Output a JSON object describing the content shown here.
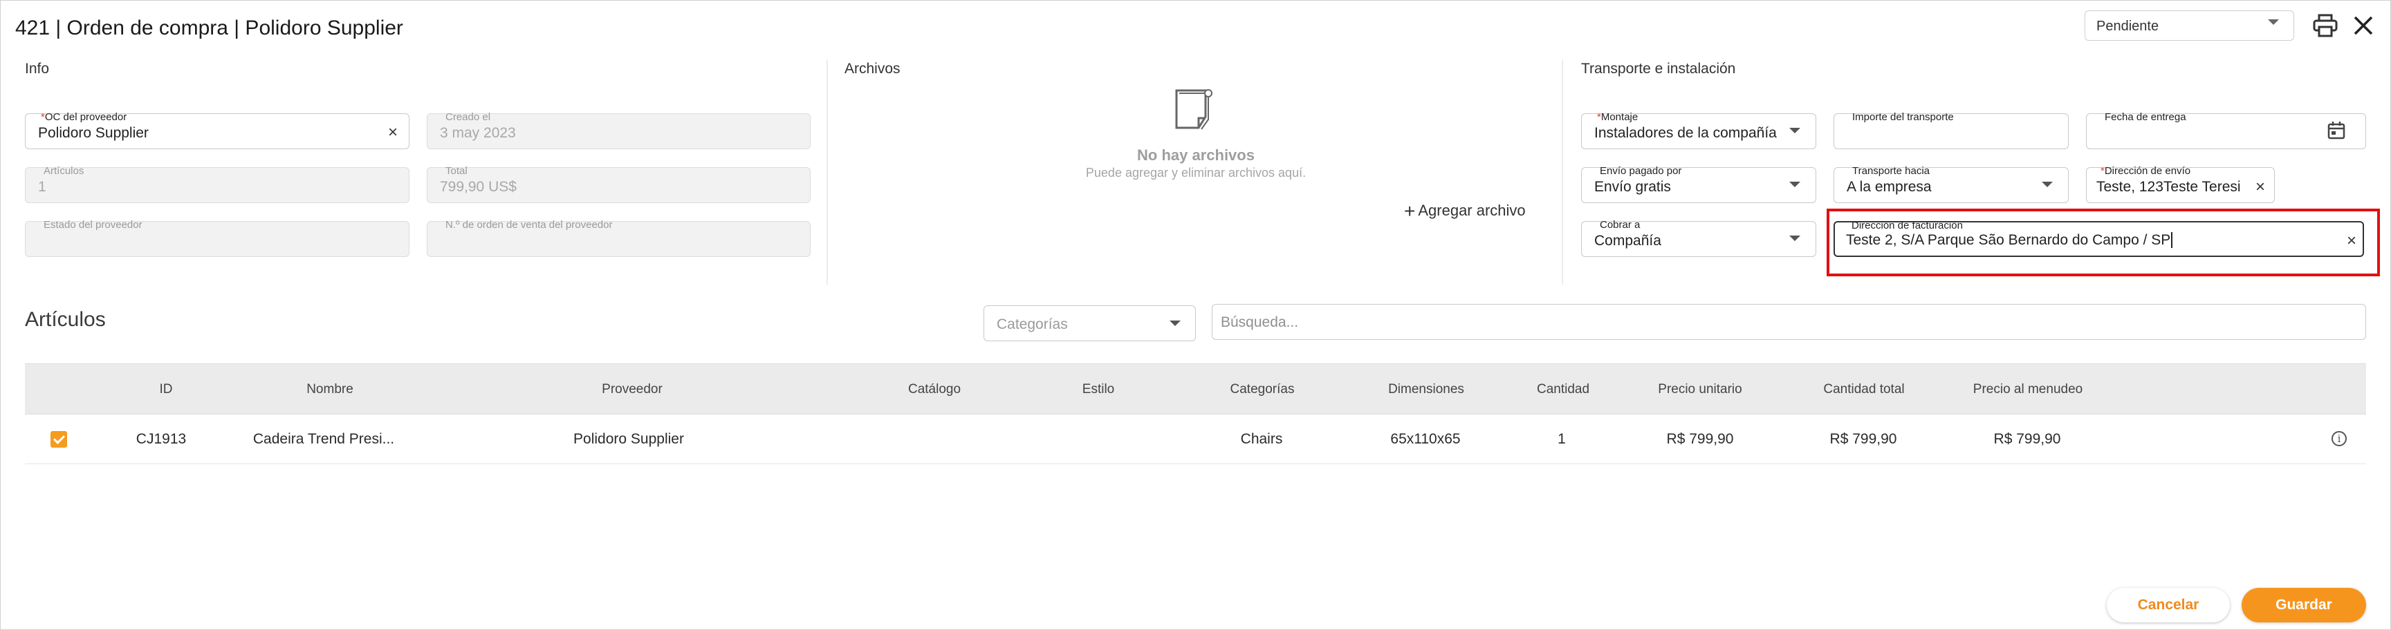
{
  "header": {
    "title": "421 | Orden de compra | Polidoro Supplier",
    "status": "Pendiente"
  },
  "info": {
    "section_title": "Info",
    "oc_label": "OC del proveedor",
    "oc_value": "Polidoro Supplier",
    "creado_label": "Creado el",
    "creado_value": "3 may 2023",
    "articulos_label": "Artículos",
    "articulos_value": "1",
    "total_label": "Total",
    "total_value": "799,90 US$",
    "estado_label": "Estado del proveedor",
    "orden_venta_label": "N.º de orden de venta del proveedor"
  },
  "archivos": {
    "section_title": "Archivos",
    "empty_title": "No hay archivos",
    "empty_subtitle": "Puede agregar y eliminar archivos aquí.",
    "add_label": "Agregar archivo"
  },
  "transporte": {
    "section_title": "Transporte e instalación",
    "montaje_label": "Montaje",
    "montaje_value": "Instaladores de la compañía",
    "importe_label": "Importe del transporte",
    "fecha_label": "Fecha de entrega",
    "envio_pagado_label": "Envío pagado por",
    "envio_pagado_value": "Envío gratis",
    "transporte_hacia_label": "Transporte hacia",
    "transporte_hacia_value": "A la empresa",
    "direccion_envio_label": "Dirección de envío",
    "direccion_envio_value": "Teste, 123Teste Teresi",
    "cobrar_label": "Cobrar a",
    "cobrar_value": "Compañía",
    "facturacion_label": "Dirección de facturación",
    "facturacion_value": "Teste 2, S/A Parque  São Bernardo do Campo / SP"
  },
  "articulos": {
    "title": "Artículos",
    "categorias_placeholder": "Categorías",
    "search_placeholder": "Búsqueda...",
    "columns": [
      "ID",
      "Nombre",
      "Proveedor",
      "Catálogo",
      "Estilo",
      "Categorías",
      "Dimensiones",
      "Cantidad",
      "Precio unitario",
      "Cantidad total",
      "Precio al menudeo"
    ],
    "rows": [
      {
        "id": "CJ1913",
        "nombre": "Cadeira Trend Presi...",
        "proveedor": "Polidoro Supplier",
        "catalogo": "",
        "estilo": "",
        "categorias": "Chairs",
        "dimensiones": "65x110x65",
        "cantidad": "1",
        "precio_unitario": "R$ 799,90",
        "cantidad_total": "R$ 799,90",
        "precio_menudeo": "R$ 799,90",
        "checked": true
      }
    ]
  },
  "footer": {
    "cancel": "Cancelar",
    "save": "Guardar"
  },
  "colors": {
    "accent": "#f6951e",
    "highlight": "#e31010"
  }
}
